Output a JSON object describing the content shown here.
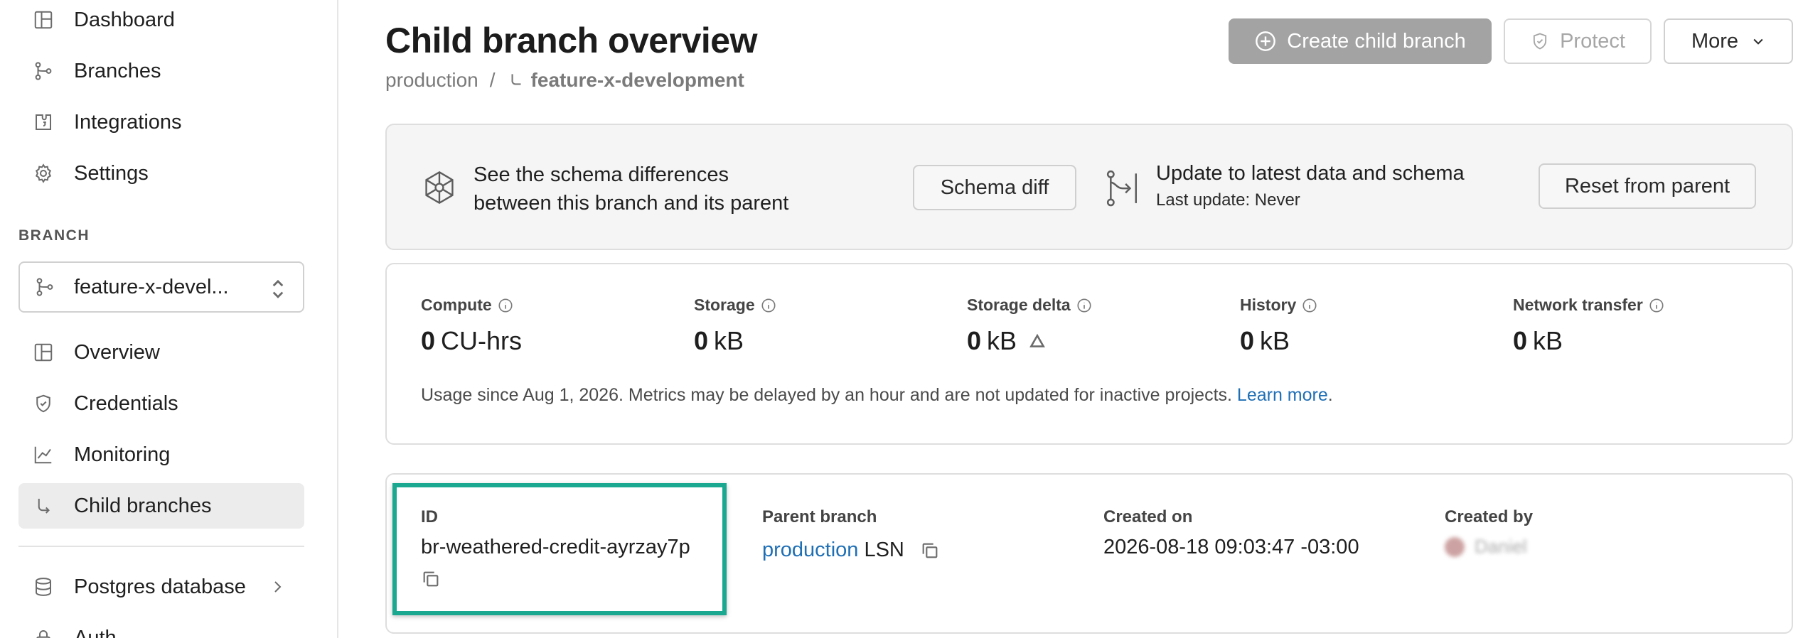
{
  "sidebar": {
    "top_items": [
      {
        "label": "Dashboard",
        "icon": "grid-icon"
      },
      {
        "label": "Branches",
        "icon": "branch-icon"
      },
      {
        "label": "Integrations",
        "icon": "puzzle-icon"
      },
      {
        "label": "Settings",
        "icon": "gear-icon"
      }
    ],
    "section_label": "BRANCH",
    "branch_selector": "feature-x-devel...",
    "branch_items": [
      {
        "label": "Overview",
        "icon": "grid-icon"
      },
      {
        "label": "Credentials",
        "icon": "shield-icon"
      },
      {
        "label": "Monitoring",
        "icon": "chart-icon"
      },
      {
        "label": "Child branches",
        "icon": "child-branch-icon"
      }
    ],
    "bottom_items": [
      {
        "label": "Postgres database",
        "icon": "database-icon"
      },
      {
        "label": "Auth",
        "icon": "lock-icon"
      }
    ]
  },
  "header": {
    "title": "Child branch overview",
    "breadcrumb_parent": "production",
    "breadcrumb_sep": "/",
    "breadcrumb_current": "feature-x-development",
    "create_label": "Create child branch",
    "protect_label": "Protect",
    "more_label": "More"
  },
  "schema_card": {
    "diff_line1": "See the schema differences",
    "diff_line2": "between this branch and its parent",
    "schema_diff_label": "Schema diff",
    "update_title": "Update to latest data and schema",
    "update_sub": "Last update: Never",
    "reset_label": "Reset from parent"
  },
  "usage": {
    "metrics": [
      {
        "label": "Compute",
        "value": "0",
        "unit": "CU-hrs"
      },
      {
        "label": "Storage",
        "value": "0",
        "unit": "kB"
      },
      {
        "label": "Storage delta",
        "value": "0",
        "unit": "kB"
      },
      {
        "label": "History",
        "value": "0",
        "unit": "kB"
      },
      {
        "label": "Network transfer",
        "value": "0",
        "unit": "kB"
      }
    ],
    "note": "Usage since Aug 1, 2026. Metrics may be delayed by an hour and are not updated for inactive projects.",
    "learn_more": "Learn more",
    "note_end": "."
  },
  "info": {
    "id_label": "ID",
    "id_value": "br-weathered-credit-ayrzay7p",
    "parent_label": "Parent branch",
    "parent_value": "production",
    "parent_lsn": "LSN",
    "created_on_label": "Created on",
    "created_on_value": "2026-08-18 09:03:47 -03:00",
    "created_by_label": "Created by",
    "created_by_value": "Daniel"
  },
  "colors": {
    "highlight": "#1aa890",
    "link": "#1f6fb5",
    "primary_disabled": "#a3a3a3"
  }
}
